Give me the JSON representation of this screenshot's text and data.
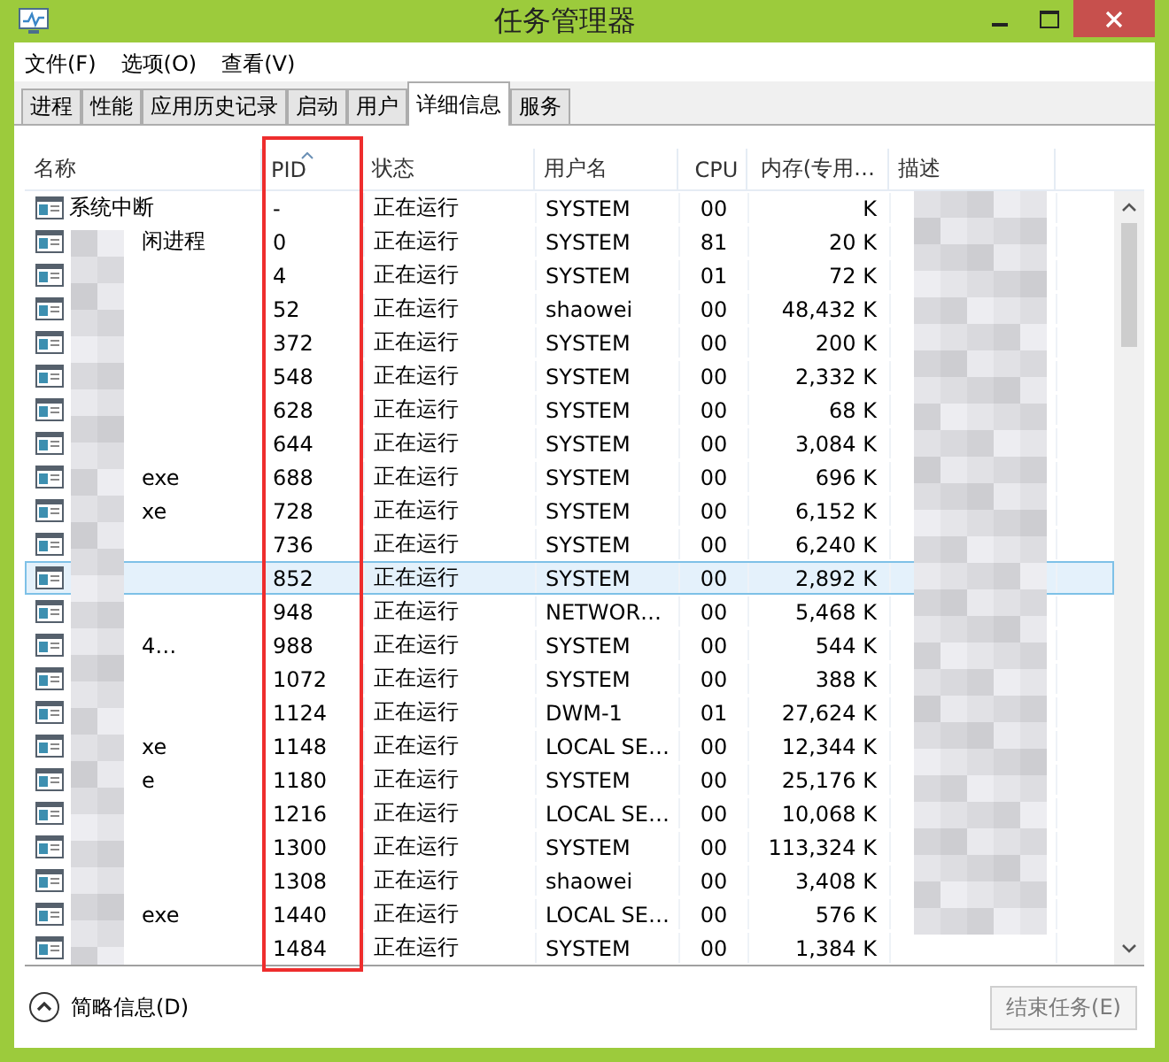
{
  "window": {
    "title": "任务管理器"
  },
  "menu": [
    "文件(F)",
    "选项(O)",
    "查看(V)"
  ],
  "tabs": [
    {
      "label": "进程",
      "selected": false
    },
    {
      "label": "性能",
      "selected": false
    },
    {
      "label": "应用历史记录",
      "selected": false
    },
    {
      "label": "启动",
      "selected": false
    },
    {
      "label": "用户",
      "selected": false
    },
    {
      "label": "详细信息",
      "selected": true
    },
    {
      "label": "服务",
      "selected": false
    }
  ],
  "table": {
    "columns": [
      {
        "label": "名称",
        "sorted": false
      },
      {
        "label": "PID",
        "sorted": true
      },
      {
        "label": "状态",
        "sorted": false
      },
      {
        "label": "用户名",
        "sorted": false
      },
      {
        "label": "CPU",
        "sorted": false
      },
      {
        "label": "内存(专用…",
        "sorted": false
      },
      {
        "label": "描述",
        "sorted": false
      }
    ],
    "rows": [
      {
        "name": "系统中断",
        "pid": "-",
        "status": "正在运行",
        "user": "SYSTEM",
        "cpu": "00",
        "memory": "K",
        "selected": false
      },
      {
        "name": "闲进程",
        "name_cut": true,
        "pid": "0",
        "status": "正在运行",
        "user": "SYSTEM",
        "cpu": "81",
        "memory": "20 K",
        "selected": false
      },
      {
        "pid": "4",
        "status": "正在运行",
        "user": "SYSTEM",
        "cpu": "01",
        "memory": "72 K",
        "selected": false
      },
      {
        "pid": "52",
        "status": "正在运行",
        "user": "shaowei",
        "cpu": "00",
        "memory": "48,432 K",
        "selected": false
      },
      {
        "pid": "372",
        "status": "正在运行",
        "user": "SYSTEM",
        "cpu": "00",
        "memory": "200 K",
        "selected": false
      },
      {
        "pid": "548",
        "status": "正在运行",
        "user": "SYSTEM",
        "cpu": "00",
        "memory": "2,332 K",
        "selected": false
      },
      {
        "pid": "628",
        "status": "正在运行",
        "user": "SYSTEM",
        "cpu": "00",
        "memory": "68 K",
        "selected": false
      },
      {
        "pid": "644",
        "status": "正在运行",
        "user": "SYSTEM",
        "cpu": "00",
        "memory": "3,084 K",
        "selected": false
      },
      {
        "name": "exe",
        "name_cut": true,
        "pid": "688",
        "status": "正在运行",
        "user": "SYSTEM",
        "cpu": "00",
        "memory": "696 K",
        "selected": false
      },
      {
        "name": "xe",
        "name_cut": true,
        "pid": "728",
        "status": "正在运行",
        "user": "SYSTEM",
        "cpu": "00",
        "memory": "6,152 K",
        "selected": false
      },
      {
        "pid": "736",
        "status": "正在运行",
        "user": "SYSTEM",
        "cpu": "00",
        "memory": "6,240 K",
        "selected": false
      },
      {
        "pid": "852",
        "status": "正在运行",
        "user": "SYSTEM",
        "cpu": "00",
        "memory": "2,892 K",
        "selected": true
      },
      {
        "pid": "948",
        "status": "正在运行",
        "user": "NETWOR…",
        "cpu": "00",
        "memory": "5,468 K",
        "selected": false
      },
      {
        "name": "4…",
        "name_cut": true,
        "pid": "988",
        "status": "正在运行",
        "user": "SYSTEM",
        "cpu": "00",
        "memory": "544 K",
        "selected": false
      },
      {
        "pid": "1072",
        "status": "正在运行",
        "user": "SYSTEM",
        "cpu": "00",
        "memory": "388 K",
        "selected": false
      },
      {
        "pid": "1124",
        "status": "正在运行",
        "user": "DWM-1",
        "cpu": "01",
        "memory": "27,624 K",
        "selected": false
      },
      {
        "name": "xe",
        "name_cut": true,
        "pid": "1148",
        "status": "正在运行",
        "user": "LOCAL SE…",
        "cpu": "00",
        "memory": "12,344 K",
        "selected": false
      },
      {
        "name": "e",
        "name_cut": true,
        "pid": "1180",
        "status": "正在运行",
        "user": "SYSTEM",
        "cpu": "00",
        "memory": "25,176 K",
        "selected": false
      },
      {
        "pid": "1216",
        "status": "正在运行",
        "user": "LOCAL SE…",
        "cpu": "00",
        "memory": "10,068 K",
        "selected": false
      },
      {
        "pid": "1300",
        "status": "正在运行",
        "user": "SYSTEM",
        "cpu": "00",
        "memory": "113,324 K",
        "selected": false
      },
      {
        "pid": "1308",
        "status": "正在运行",
        "user": "shaowei",
        "cpu": "00",
        "memory": "3,408 K",
        "selected": false
      },
      {
        "name": "exe",
        "name_cut": true,
        "pid": "1440",
        "status": "正在运行",
        "user": "LOCAL SE…",
        "cpu": "00",
        "memory": "576 K",
        "selected": false
      },
      {
        "pid": "1484",
        "status": "正在运行",
        "user": "SYSTEM",
        "cpu": "00",
        "memory": "1,384 K",
        "selected": false
      }
    ]
  },
  "footer": {
    "details_toggle": "简略信息(D)",
    "end_task": {
      "label": "结束任务(E)",
      "disabled": true
    }
  }
}
